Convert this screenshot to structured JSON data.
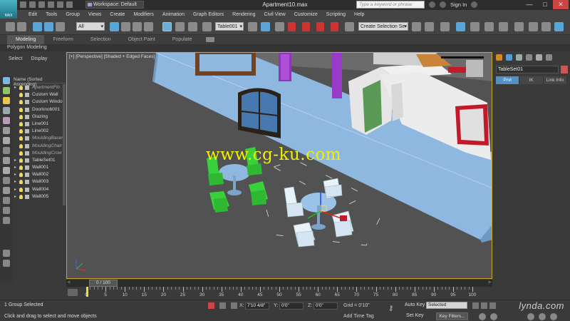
{
  "titlebar": {
    "logo": "MAX",
    "workspace": "Workspace: Default",
    "title": "Apartment10.max",
    "search_placeholder": "Type a keyword or phrase",
    "signin": "Sign In",
    "min": "—",
    "max": "□",
    "close": "✕"
  },
  "menu": [
    "Edit",
    "Tools",
    "Group",
    "Views",
    "Create",
    "Modifiers",
    "Animation",
    "Graph Editors",
    "Rendering",
    "Civil View",
    "Customize",
    "Scripting",
    "Help"
  ],
  "toolbar": {
    "filter_value": "All",
    "named_selection": "Table001",
    "view_value": "View",
    "create_selection_set": "Create Selection Se",
    "snap_angle": "3",
    "snap_percent": "%"
  },
  "ribbon": {
    "tabs": [
      "Modeling",
      "Freeform",
      "Selection",
      "Object Paint",
      "Populate"
    ],
    "active_tab": "Modeling",
    "sub_label": "Polygon Modeling"
  },
  "explorer": {
    "tabs": [
      "Select",
      "Display"
    ],
    "header": "Name (Sorted Ascending)",
    "items": [
      {
        "name": "ApartmentFlo",
        "dim": true,
        "expand": "▸"
      },
      {
        "name": "Custom Wall",
        "dim": false,
        "expand": ""
      },
      {
        "name": "Custom Windo",
        "dim": false,
        "expand": ""
      },
      {
        "name": "Doorknob001",
        "dim": false,
        "expand": ""
      },
      {
        "name": "Glazing",
        "dim": false,
        "expand": ""
      },
      {
        "name": "Line001",
        "dim": false,
        "expand": ""
      },
      {
        "name": "Line002",
        "dim": false,
        "expand": ""
      },
      {
        "name": "MouldingBaser",
        "dim": true,
        "expand": ""
      },
      {
        "name": "MouldingChair",
        "dim": true,
        "expand": ""
      },
      {
        "name": "MouldingCrow",
        "dim": true,
        "expand": ""
      },
      {
        "name": "TableSet01",
        "dim": false,
        "expand": "▸"
      },
      {
        "name": "Wall001",
        "dim": false,
        "expand": "▸"
      },
      {
        "name": "Wall002",
        "dim": false,
        "expand": "▸"
      },
      {
        "name": "Wall003",
        "dim": false,
        "expand": "▸"
      },
      {
        "name": "Wall004",
        "dim": false,
        "expand": "▸"
      },
      {
        "name": "Wall005",
        "dim": false,
        "expand": "▸"
      }
    ]
  },
  "viewport": {
    "label": "[+] [Perspective] [Shaded + Edged Faces]",
    "watermark": "www.cg-ku.com"
  },
  "command_panel": {
    "object_name": "TableSet01",
    "tabs": [
      "Prvt",
      "IK",
      "Link Info"
    ],
    "active_tab": "Prvt"
  },
  "timeslider": {
    "position": "0 / 100",
    "left_arrow": "<",
    "right_arrow": ">"
  },
  "trackbar": {
    "ticks": [
      0,
      5,
      10,
      15,
      20,
      25,
      30,
      35,
      40,
      45,
      50,
      55,
      60,
      65,
      70,
      75,
      80,
      85,
      90,
      95,
      100
    ]
  },
  "status": {
    "selection": "1 Group Selected",
    "prompt": "Click and drag to select and move objects",
    "x_label": "X:",
    "x_value": "7'10 4/8\"",
    "y_label": "Y:",
    "y_value": "0'0\"",
    "z_label": "Z:",
    "z_value": "0'0\"",
    "grid": "Grid = 0'10\"",
    "add_time_tag": "Add Time Tag",
    "auto_key": "Auto Key",
    "set_key": "Set Key",
    "selected": "Selected",
    "key_filters": "Key Filters...",
    "brand": "lynda.com"
  },
  "colors": {
    "accent_blue": "#58a5d6",
    "viewport_border": "#c8a42a",
    "watermark": "#f0f000",
    "chair_green": "#39d13b",
    "chair_white": "#e8f2fa",
    "wall_blue": "#8fb8e0"
  }
}
